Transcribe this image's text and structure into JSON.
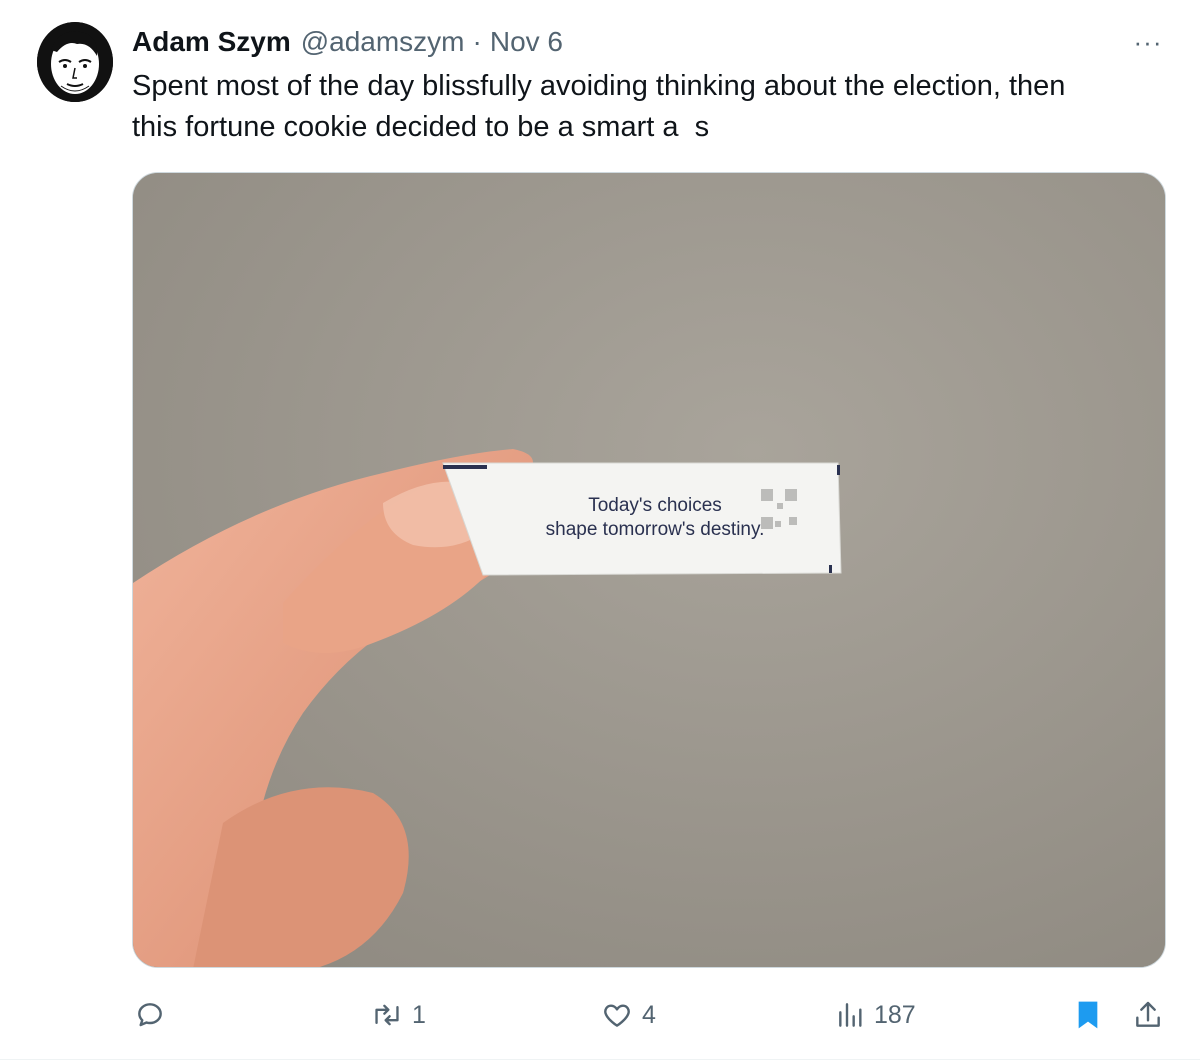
{
  "tweet": {
    "author_name": "Adam Szym",
    "handle": "@adamszym",
    "separator": "·",
    "date": "Nov 6",
    "more_label": "···",
    "text": "Spent most of the day blissfully avoiding thinking about the election, then\nthis fortune cookie decided to be a smart a  s"
  },
  "media": {
    "fortune_line_1": "Today's choices",
    "fortune_line_2": "shape tomorrow's destiny."
  },
  "actions": {
    "reply_count": "",
    "retweet_count": "1",
    "like_count": "4",
    "views_count": "187"
  },
  "colors": {
    "secondary_text": "#536471",
    "bookmark_active": "#1d9bf0",
    "wall": "#9a958c"
  },
  "icons": {
    "reply": "reply-icon",
    "retweet": "retweet-icon",
    "like": "heart-icon",
    "views": "views-icon",
    "bookmark": "bookmark-icon",
    "share": "share-icon",
    "more": "more-icon"
  }
}
